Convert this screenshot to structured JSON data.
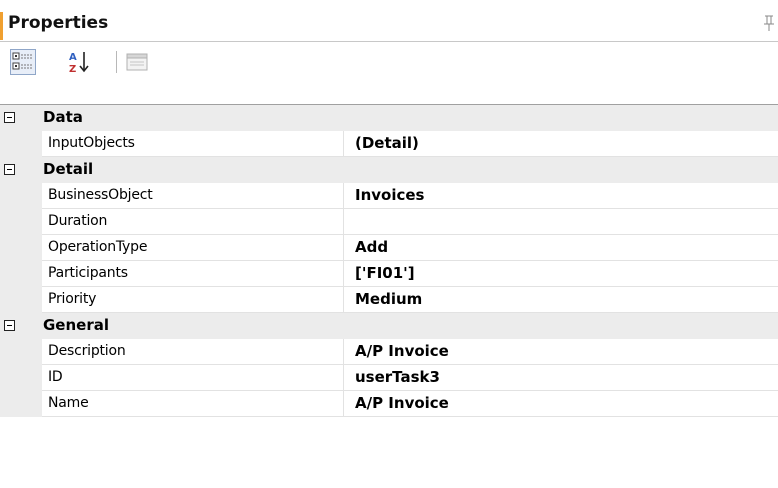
{
  "panel": {
    "title": "Properties"
  },
  "toolbar": {
    "buttons": [
      {
        "name": "categorized-icon"
      },
      {
        "name": "sort-alphabetical-icon"
      },
      {
        "name": "property-pages-icon"
      }
    ]
  },
  "grid": {
    "categories": [
      {
        "label": "Data",
        "properties": [
          {
            "name": "InputObjects",
            "value": "(Detail)"
          }
        ]
      },
      {
        "label": "Detail",
        "properties": [
          {
            "name": "BusinessObject",
            "value": "Invoices"
          },
          {
            "name": "Duration",
            "value": ""
          },
          {
            "name": "OperationType",
            "value": "Add"
          },
          {
            "name": "Participants",
            "value": "['FI01']"
          },
          {
            "name": "Priority",
            "value": "Medium"
          }
        ]
      },
      {
        "label": "General",
        "properties": [
          {
            "name": "Description",
            "value": "A/P Invoice"
          },
          {
            "name": "ID",
            "value": "userTask3"
          },
          {
            "name": "Name",
            "value": "A/P Invoice"
          }
        ]
      }
    ]
  }
}
